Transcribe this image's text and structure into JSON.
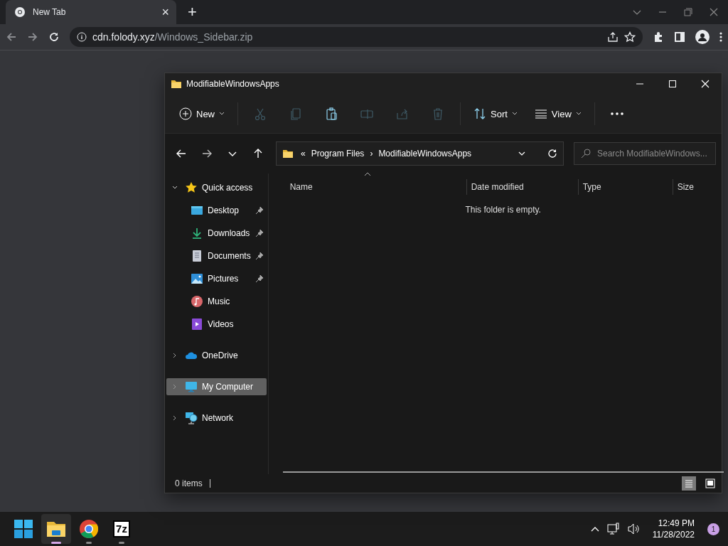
{
  "browser": {
    "tab": {
      "title": "New Tab",
      "close": "×",
      "selected": true
    },
    "new_tab": "+",
    "address": {
      "domain": "cdn.folody.xyz",
      "path": "/Windows_Sidebar.zip"
    }
  },
  "explorer": {
    "title": "ModifiableWindowsApps",
    "toolbar": {
      "new": {
        "label": "New"
      },
      "actions": [
        {
          "disabled": true
        },
        {
          "disabled": true
        },
        {
          "disabled": false
        },
        {
          "disabled": true
        },
        {
          "disabled": true
        },
        {
          "disabled": true
        }
      ],
      "sort": {
        "label": "Sort"
      },
      "view": {
        "label": "View"
      }
    },
    "breadcrumb": {
      "overflow": "«",
      "parts": [
        "Program Files",
        "ModifiableWindowsApps"
      ],
      "separator": "›"
    },
    "search": {
      "placeholder": "Search ModifiableWindows..."
    },
    "nav": [
      {
        "label": "Quick access",
        "expanded": true,
        "selected": false,
        "children": [
          {
            "label": "Desktop",
            "pinned": true,
            "selected": false
          },
          {
            "label": "Downloads",
            "pinned": true,
            "selected": false
          },
          {
            "label": "Documents",
            "pinned": true,
            "selected": false
          },
          {
            "label": "Pictures",
            "pinned": true,
            "selected": false
          },
          {
            "label": "Music",
            "pinned": false,
            "selected": false
          },
          {
            "label": "Videos",
            "pinned": false,
            "selected": false
          }
        ]
      },
      {
        "label": "OneDrive",
        "expanded": false,
        "selected": false
      },
      {
        "label": "My Computer",
        "expanded": false,
        "selected": true
      },
      {
        "label": "Network",
        "expanded": false,
        "selected": false
      }
    ],
    "columns": [
      {
        "label": "Name",
        "sorted": true
      },
      {
        "label": "Date modified",
        "sorted": false
      },
      {
        "label": "Type",
        "sorted": false
      },
      {
        "label": "Size",
        "sorted": false
      }
    ],
    "empty_message": "This folder is empty.",
    "status": {
      "count": "0 items",
      "views": [
        {
          "selected": true
        },
        {
          "selected": false
        }
      ]
    }
  },
  "taskbar": {
    "apps": [
      {
        "selected": false,
        "running": false
      },
      {
        "selected": true,
        "running": true
      },
      {
        "selected": false,
        "running": true
      },
      {
        "label": "7z",
        "selected": false,
        "running": true
      }
    ],
    "time": "12:49 PM",
    "date": "11/28/2022",
    "notifications": "1"
  }
}
